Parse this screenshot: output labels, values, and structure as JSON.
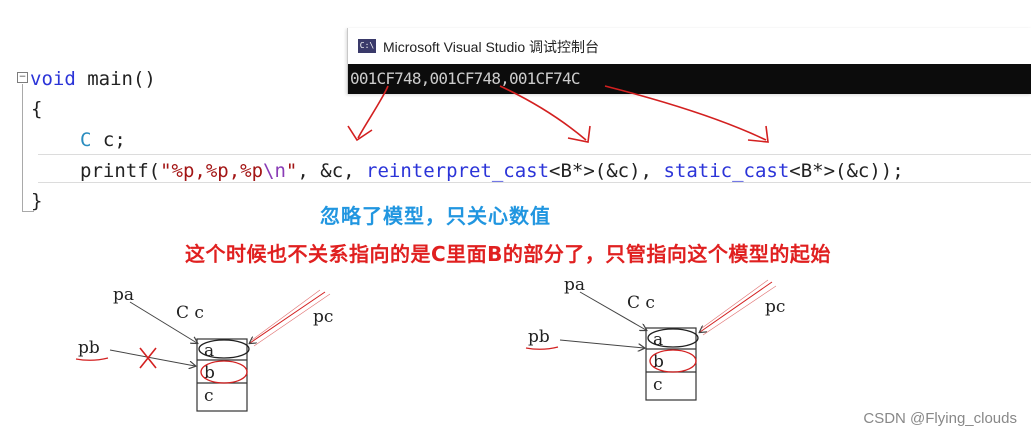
{
  "console": {
    "title": "Microsoft Visual Studio 调试控制台",
    "icon_label": "C:\\",
    "output": "001CF748,001CF748,001CF74C"
  },
  "code": {
    "line1": {
      "keyword": "void",
      "rest": " main()"
    },
    "line2": "{",
    "line3": {
      "type": "C",
      "rest": " c;"
    },
    "line4": {
      "fn": "printf(",
      "str_open": "\"%p,%p,%p",
      "esc": "\\n",
      "str_close": "\"",
      "arg1": ", &c, ",
      "cast1": "reinterpret_cast",
      "arg2": "<B*>(&c), ",
      "cast2": "static_cast",
      "arg3": "<B*>(&c));"
    },
    "line5": "}",
    "fold_marker": "⊟"
  },
  "notes": {
    "blue": "忽略了模型，只关心数值",
    "red": "这个时候也不关系指向的是C里面B的部分了，只管指向这个模型的起始"
  },
  "diagram_left": {
    "pa": "pa",
    "pb": "pb",
    "pc": "pc",
    "class_label": "C c",
    "cells": [
      "a",
      "b",
      "c"
    ]
  },
  "diagram_right": {
    "pa": "pa",
    "pb": "pb",
    "pc": "pc",
    "class_label": "C c",
    "cells": [
      "a",
      "b",
      "c"
    ]
  },
  "watermark": "CSDN @Flying_clouds"
}
